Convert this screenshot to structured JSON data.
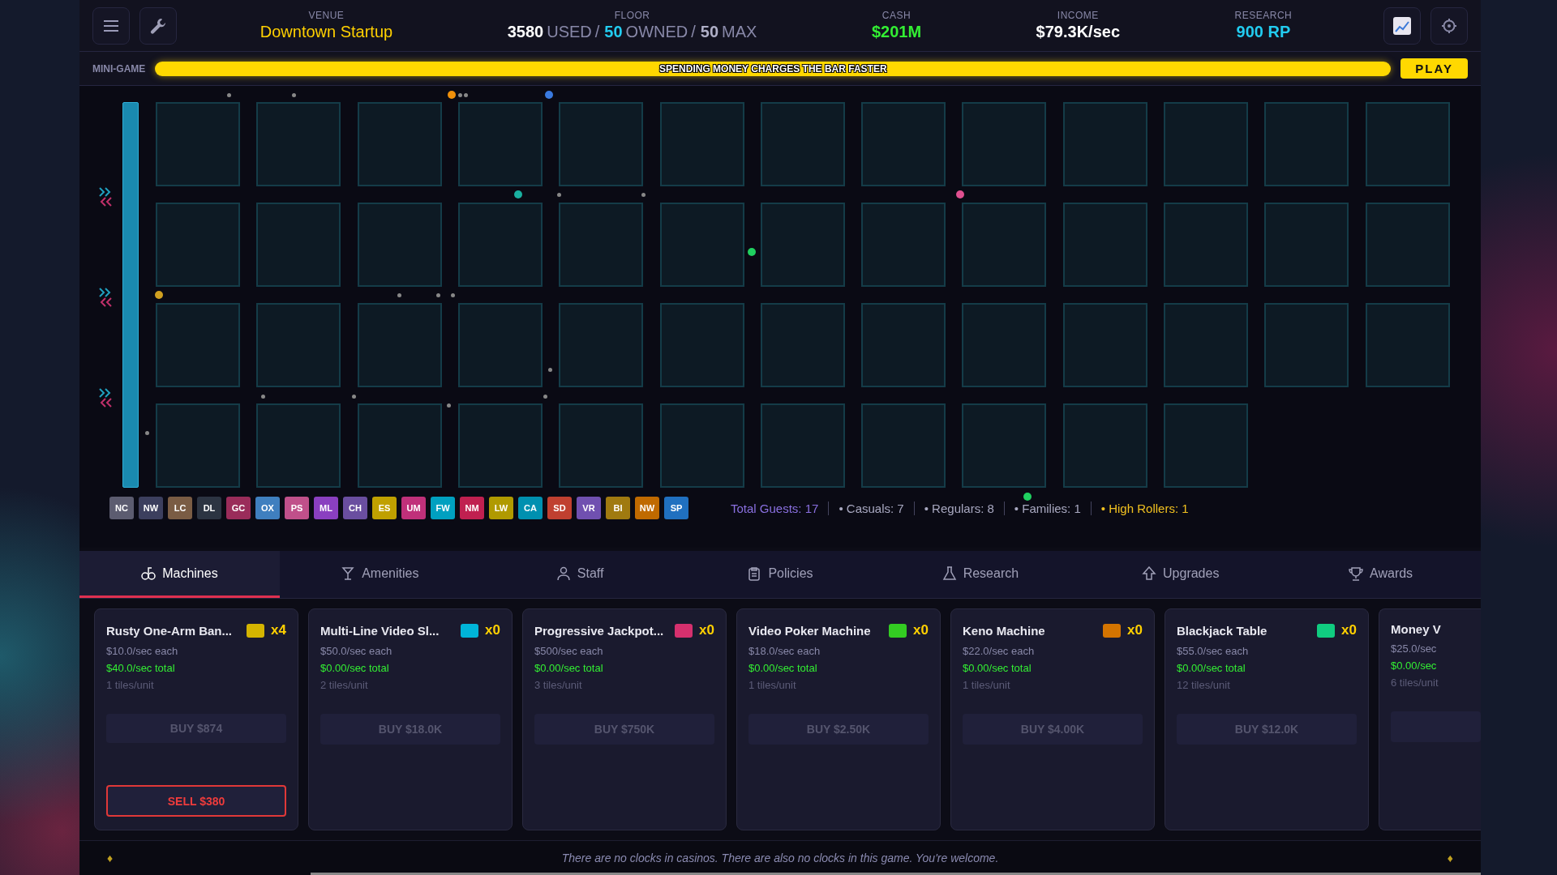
{
  "header": {
    "stats": [
      {
        "label": "VENUE",
        "kind": "venue",
        "value": "Downtown Startup"
      },
      {
        "label": "FLOOR",
        "kind": "floor",
        "parts": [
          {
            "text": "3580",
            "kind": "used"
          },
          {
            "text": "USED",
            "kind": "unit"
          },
          {
            "text": "/",
            "kind": "sep"
          },
          {
            "text": "50",
            "kind": "owned"
          },
          {
            "text": "OWNED",
            "kind": "unit"
          },
          {
            "text": "/",
            "kind": "sep"
          },
          {
            "text": "50",
            "kind": "max"
          },
          {
            "text": "MAX",
            "kind": "unit"
          }
        ]
      },
      {
        "label": "CASH",
        "kind": "cash",
        "value": "$201M"
      },
      {
        "label": "INCOME",
        "kind": "income",
        "value": "$79.3K/sec"
      },
      {
        "label": "RESEARCH",
        "kind": "research",
        "value": "900 RP"
      }
    ]
  },
  "minigame": {
    "label": "MINI-GAME",
    "level": 1,
    "bar_text": "SPENDING MONEY CHARGES THE BAR FASTER",
    "button": "PLAY"
  },
  "badges": [
    {
      "text": "NC",
      "color": "#5c5c70"
    },
    {
      "text": "NW",
      "color": "#3c3f5e"
    },
    {
      "text": "LC",
      "color": "#7a5c44"
    },
    {
      "text": "DL",
      "color": "#2c3442"
    },
    {
      "text": "GC",
      "color": "#9a2c5a"
    },
    {
      "text": "OX",
      "color": "#3f7fbf"
    },
    {
      "text": "PS",
      "color": "#c0508a"
    },
    {
      "text": "ML",
      "color": "#8a3fc0"
    },
    {
      "text": "CH",
      "color": "#6a4ea0"
    },
    {
      "text": "ES",
      "color": "#c0a000"
    },
    {
      "text": "UM",
      "color": "#c0307a"
    },
    {
      "text": "FW",
      "color": "#00a0c0"
    },
    {
      "text": "NM",
      "color": "#c02050"
    },
    {
      "text": "LW",
      "color": "#b09a00"
    },
    {
      "text": "CA",
      "color": "#0090b0"
    },
    {
      "text": "SD",
      "color": "#c04030"
    },
    {
      "text": "VR",
      "color": "#7050b0"
    },
    {
      "text": "BI",
      "color": "#a07a10"
    },
    {
      "text": "NW",
      "color": "#c06a00"
    },
    {
      "text": "SP",
      "color": "#2070c0"
    }
  ],
  "guest_stats": [
    {
      "text": "Total Guests: 17",
      "kind": "total"
    },
    {
      "text": "• Casuals: 7",
      "kind": "plain"
    },
    {
      "text": "• Regulars: 8",
      "kind": "plain"
    },
    {
      "text": "• Families: 1",
      "kind": "plain"
    },
    {
      "text": "• High Rollers: 1",
      "kind": "highlight"
    }
  ],
  "tabs": [
    {
      "label": "Machines",
      "selected": true
    },
    {
      "label": "Amenities",
      "selected": false
    },
    {
      "label": "Staff",
      "selected": false
    },
    {
      "label": "Policies",
      "selected": false
    },
    {
      "label": "Research",
      "selected": false
    },
    {
      "label": "Upgrades",
      "selected": false
    },
    {
      "label": "Awards",
      "selected": false
    }
  ],
  "cards": [
    {
      "name": "Rusty One-Arm Ban...",
      "color": "#d4b400",
      "count": "x4",
      "each": "$10.0/sec each",
      "total": "$40.0/sec total",
      "tiles": "1 tiles/unit",
      "buy": "BUY $874",
      "buy_disabled": true,
      "sell": "SELL $380"
    },
    {
      "name": "Multi-Line Video Sl...",
      "color": "#00b4d8",
      "count": "x0",
      "each": "$50.0/sec each",
      "total": "$0.00/sec total",
      "tiles": "2 tiles/unit",
      "buy": "BUY $18.0K",
      "buy_disabled": true
    },
    {
      "name": "Progressive Jackpot...",
      "color": "#d6306e",
      "count": "x0",
      "each": "$500/sec each",
      "total": "$0.00/sec total",
      "tiles": "3 tiles/unit",
      "buy": "BUY $750K",
      "buy_disabled": true
    },
    {
      "name": "Video Poker Machine",
      "color": "#33cc22",
      "count": "x0",
      "each": "$18.0/sec each",
      "total": "$0.00/sec total",
      "tiles": "1 tiles/unit",
      "buy": "BUY $2.50K",
      "buy_disabled": true
    },
    {
      "name": "Keno Machine",
      "color": "#d47400",
      "count": "x0",
      "each": "$22.0/sec each",
      "total": "$0.00/sec total",
      "tiles": "1 tiles/unit",
      "buy": "BUY $4.00K",
      "buy_disabled": true
    },
    {
      "name": "Blackjack Table",
      "color": "#10cc80",
      "count": "x0",
      "each": "$55.0/sec each",
      "total": "$0.00/sec total",
      "tiles": "12 tiles/unit",
      "buy": "BUY $12.0K",
      "buy_disabled": true
    },
    {
      "name": "Money V",
      "each": "$25.0/sec",
      "total": "$0.00/sec",
      "tiles": "6 tiles/unit",
      "buy_disabled": true
    }
  ],
  "footer": {
    "left": "♦",
    "text": "There are no clocks in casinos. There are also no clocks in this game. You're welcome.",
    "right": "♦"
  }
}
